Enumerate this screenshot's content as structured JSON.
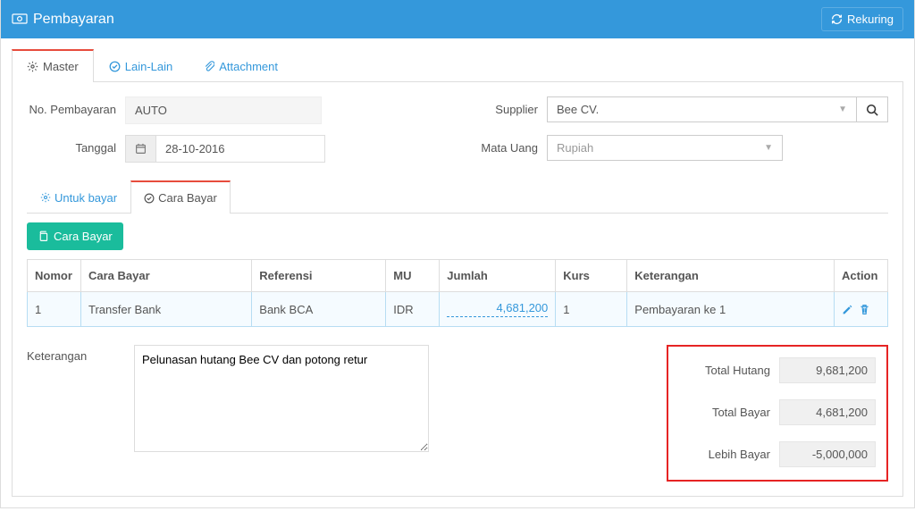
{
  "header": {
    "title": "Pembayaran",
    "rekuring": "Rekuring"
  },
  "tabs": {
    "master": "Master",
    "lain": "Lain-Lain",
    "attachment": "Attachment"
  },
  "form": {
    "no_label": "No. Pembayaran",
    "no_value": "AUTO",
    "tanggal_label": "Tanggal",
    "tanggal_value": "28-10-2016",
    "supplier_label": "Supplier",
    "supplier_value": "Bee CV.",
    "mata_uang_label": "Mata Uang",
    "mata_uang_value": "Rupiah"
  },
  "sub_tabs": {
    "untuk_bayar": "Untuk bayar",
    "cara_bayar": "Cara Bayar"
  },
  "add_btn": "Cara Bayar",
  "table": {
    "headers": {
      "nomor": "Nomor",
      "cara_bayar": "Cara Bayar",
      "referensi": "Referensi",
      "mu": "MU",
      "jumlah": "Jumlah",
      "kurs": "Kurs",
      "keterangan": "Keterangan",
      "action": "Action"
    },
    "rows": [
      {
        "nomor": "1",
        "cara_bayar": "Transfer Bank",
        "referensi": "Bank BCA",
        "mu": "IDR",
        "jumlah": "4,681,200",
        "kurs": "1",
        "keterangan": "Pembayaran ke 1"
      }
    ]
  },
  "footer": {
    "ket_label": "Keterangan",
    "ket_value": "Pelunasan hutang Bee CV dan potong retur",
    "totals": {
      "hutang_label": "Total Hutang",
      "hutang_value": "9,681,200",
      "bayar_label": "Total Bayar",
      "bayar_value": "4,681,200",
      "lebih_label": "Lebih Bayar",
      "lebih_value": "-5,000,000"
    }
  }
}
